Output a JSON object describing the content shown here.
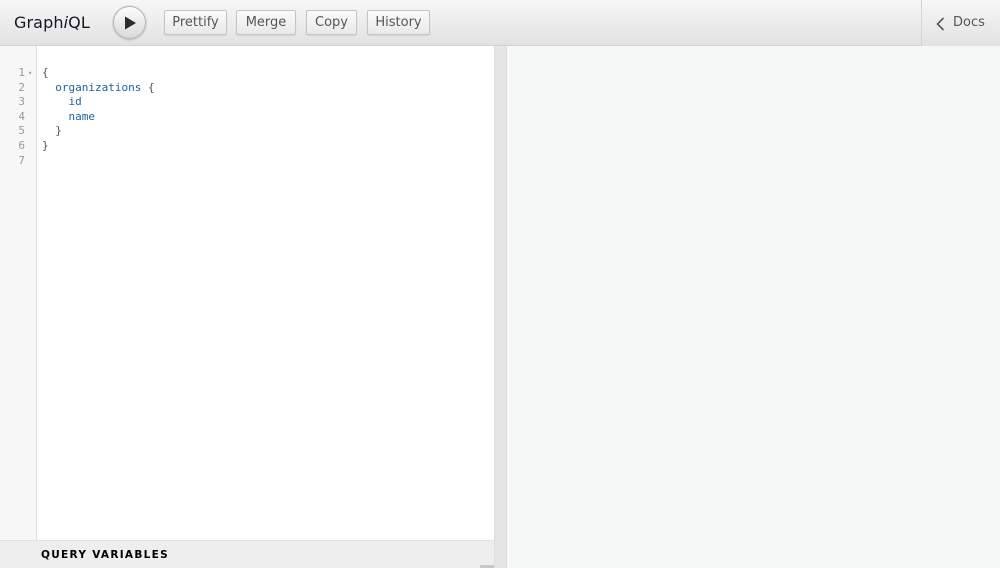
{
  "toolbar": {
    "title_prefix": "Graph",
    "title_em": "i",
    "title_suffix": "QL",
    "prettify_label": "Prettify",
    "merge_label": "Merge",
    "copy_label": "Copy",
    "history_label": "History",
    "docs_label": "Docs"
  },
  "editor": {
    "lines": [
      {
        "num": "1",
        "fold": "▾",
        "tokens": [
          {
            "t": "{",
            "k": "punct"
          }
        ]
      },
      {
        "num": "2",
        "tokens": [
          {
            "t": "  ",
            "k": "ws"
          },
          {
            "t": "organizations",
            "k": "field"
          },
          {
            "t": " {",
            "k": "punct"
          }
        ]
      },
      {
        "num": "3",
        "tokens": [
          {
            "t": "    ",
            "k": "ws"
          },
          {
            "t": "id",
            "k": "field"
          }
        ]
      },
      {
        "num": "4",
        "tokens": [
          {
            "t": "    ",
            "k": "ws"
          },
          {
            "t": "name",
            "k": "field"
          }
        ]
      },
      {
        "num": "5",
        "tokens": [
          {
            "t": "  ",
            "k": "ws"
          },
          {
            "t": "}",
            "k": "punct"
          }
        ]
      },
      {
        "num": "6",
        "tokens": [
          {
            "t": "}",
            "k": "punct"
          }
        ]
      },
      {
        "num": "7",
        "tokens": []
      }
    ]
  },
  "variables": {
    "label": "QUERY VARIABLES"
  },
  "icons": {
    "run": "play-icon",
    "docs": "chevron-left-icon"
  },
  "colors": {
    "field": "#1f61a0",
    "punct": "#555555",
    "line_number": "#999999"
  }
}
